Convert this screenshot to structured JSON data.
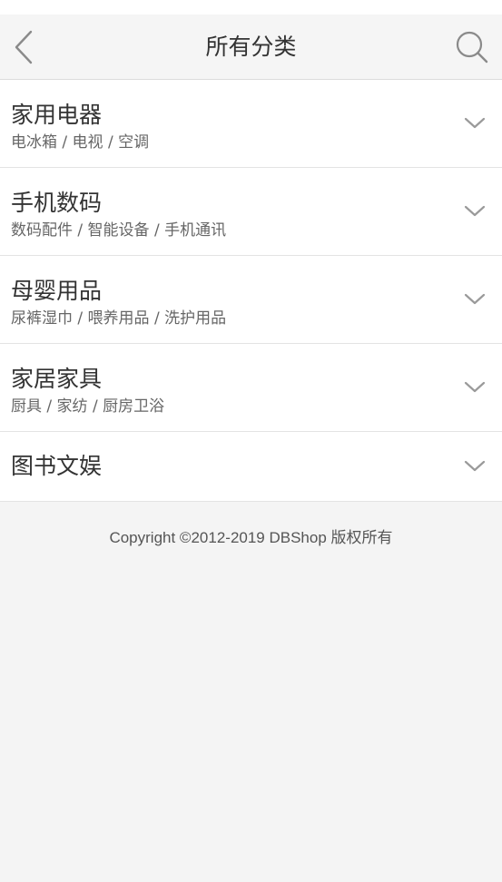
{
  "header": {
    "title": "所有分类",
    "back_icon": "chevron-left-icon",
    "search_icon": "search-icon"
  },
  "categories": [
    {
      "name": "家用电器",
      "sub": "电冰箱 / 电视 / 空调"
    },
    {
      "name": "手机数码",
      "sub": "数码配件 / 智能设备 / 手机通讯"
    },
    {
      "name": "母婴用品",
      "sub": "尿裤湿巾 / 喂养用品 / 洗护用品"
    },
    {
      "name": "家居家具",
      "sub": "厨具 / 家纺 / 厨房卫浴"
    },
    {
      "name": "图书文娱",
      "sub": ""
    }
  ],
  "footer": {
    "copyright": "Copyright ©2012-2019 DBShop 版权所有"
  },
  "colors": {
    "header_bg": "#f5f5f5",
    "page_bg": "#f4f4f4",
    "list_bg": "#ffffff",
    "divider": "#e3e3e3",
    "icon": "#999999"
  }
}
